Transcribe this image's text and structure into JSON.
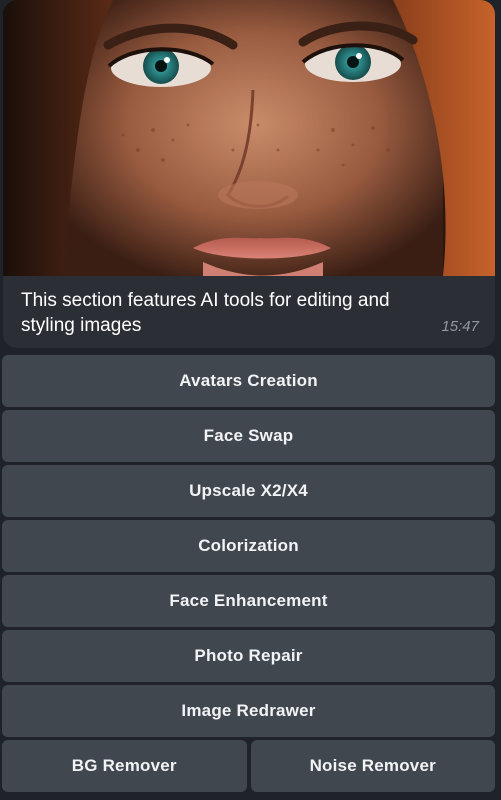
{
  "message": {
    "caption": "This section features AI tools for editing and styling images",
    "time": "15:47"
  },
  "keyboard": {
    "rows": [
      [
        "Avatars Creation"
      ],
      [
        "Face Swap"
      ],
      [
        "Upscale X2/X4"
      ],
      [
        "Colorization"
      ],
      [
        "Face Enhancement"
      ],
      [
        "Photo Repair"
      ],
      [
        "Image Redrawer"
      ],
      [
        "BG Remover",
        "Noise Remover"
      ]
    ]
  },
  "colors": {
    "background": "#1f2329",
    "bubble": "#2b2f35",
    "button": "#41474f",
    "time": "#8f98a3"
  }
}
